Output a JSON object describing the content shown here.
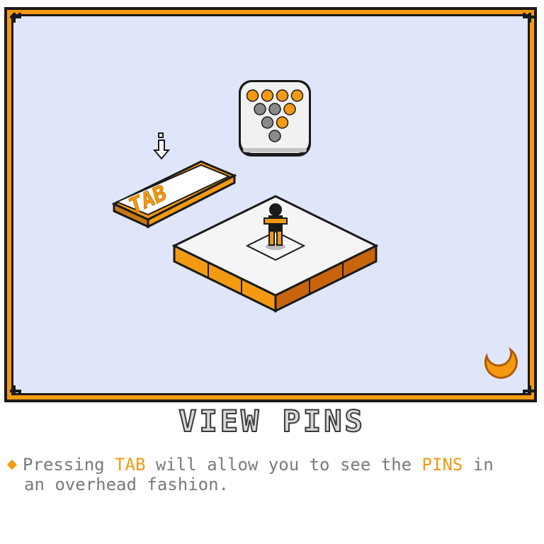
{
  "tutorial": {
    "title": "VIEW PINS",
    "description": {
      "prefix": "Pressing ",
      "key": "TAB",
      "middle": " will allow you to see the ",
      "pins_word": "PINS",
      "suffix_line1": " in",
      "line2": "an overhead fashion."
    }
  },
  "illustration": {
    "key_label": "TAB",
    "pins": [
      {
        "row": 1,
        "colors": [
          "orange",
          "orange",
          "orange",
          "orange"
        ]
      },
      {
        "row": 2,
        "colors": [
          "gray",
          "gray",
          "orange"
        ]
      },
      {
        "row": 3,
        "colors": [
          "gray",
          "orange"
        ]
      },
      {
        "row": 4,
        "colors": [
          "gray"
        ]
      }
    ],
    "icons": [
      "down-arrow-icon",
      "bowling-pins-icon",
      "tab-key-icon",
      "platform",
      "player-character",
      "loading-crescent-icon"
    ]
  },
  "colors": {
    "accent": "#f39a12",
    "frame": "#1a1a1a",
    "background": "#dfe6fa",
    "text": "#7a7a7a"
  }
}
